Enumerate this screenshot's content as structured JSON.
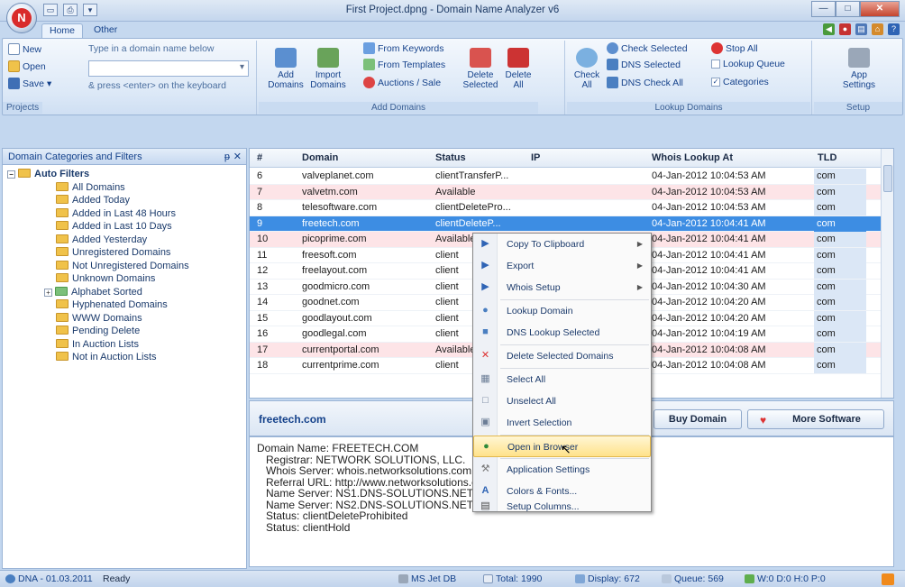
{
  "window": {
    "title": "First Project.dpng - Domain Name Analyzer v6",
    "app_letter": "N"
  },
  "tabs": [
    "Home",
    "Other"
  ],
  "ribbon": {
    "projects": {
      "new": "New",
      "open": "Open",
      "save": "Save",
      "save_arrow": "▾",
      "label": "Projects",
      "hint_top": "Type in a domain name below",
      "hint_bottom": "& press <enter> on the keyboard"
    },
    "add_domains": {
      "add": "Add Domains",
      "import": "Import Domains",
      "from_keywords": "From Keywords",
      "from_templates": "From Templates",
      "auctions": "Auctions / Sale",
      "delete_selected": "Delete Selected",
      "delete_all": "Delete All",
      "label": "Add Domains"
    },
    "lookup": {
      "check_all": "Check All",
      "check_selected": "Check Selected",
      "dns_selected": "DNS Selected",
      "dns_check_all": "DNS Check All",
      "stop_all": "Stop All",
      "lookup_queue": "Lookup Queue",
      "categories": "Categories",
      "label": "Lookup Domains"
    },
    "setup": {
      "app_settings": "App Settings",
      "label": "Setup"
    }
  },
  "left_pane": {
    "title": "Domain Categories and Filters",
    "pin": "ᵽ",
    "close": "✕",
    "exp_minus": "−",
    "exp_plus": "+",
    "root": "Auto Filters",
    "items": [
      "All Domains",
      "Added Today",
      "Added in Last 48 Hours",
      "Added in Last 10 Days",
      "Added Yesterday",
      "Unregistered Domains",
      "Not Unregistered Domains",
      "Unknown Domains",
      "Alphabet Sorted",
      "Hyphenated Domains",
      "WWW Domains",
      "Pending Delete",
      "In Auction Lists",
      "Not in Auction Lists"
    ]
  },
  "grid": {
    "headers": {
      "num": "#",
      "domain": "Domain",
      "status": "Status",
      "ip": "IP",
      "whois": "Whois Lookup At",
      "tld": "TLD"
    },
    "rows": [
      {
        "n": "6",
        "domain": "valveplanet.com",
        "status": "clientTransferP...",
        "whois": "04-Jan-2012 10:04:53 AM",
        "tld": "com",
        "kind": "normal"
      },
      {
        "n": "7",
        "domain": "valvetm.com",
        "status": "Available",
        "whois": "04-Jan-2012 10:04:53 AM",
        "tld": "com",
        "kind": "avail"
      },
      {
        "n": "8",
        "domain": "telesoftware.com",
        "status": "clientDeletePro...",
        "whois": "04-Jan-2012 10:04:53 AM",
        "tld": "com",
        "kind": "normal"
      },
      {
        "n": "9",
        "domain": "freetech.com",
        "status": "clientDeleteP...",
        "whois": "04-Jan-2012 10:04:41 AM",
        "tld": "com",
        "kind": "sel"
      },
      {
        "n": "10",
        "domain": "picoprime.com",
        "status": "Available",
        "whois": "04-Jan-2012 10:04:41 AM",
        "tld": "com",
        "kind": "avail"
      },
      {
        "n": "11",
        "domain": "freesoft.com",
        "status": "client",
        "whois": "04-Jan-2012 10:04:41 AM",
        "tld": "com",
        "kind": "normal"
      },
      {
        "n": "12",
        "domain": "freelayout.com",
        "status": "client",
        "whois": "04-Jan-2012 10:04:41 AM",
        "tld": "com",
        "kind": "normal"
      },
      {
        "n": "13",
        "domain": "goodmicro.com",
        "status": "client",
        "whois": "04-Jan-2012 10:04:30 AM",
        "tld": "com",
        "kind": "normal"
      },
      {
        "n": "14",
        "domain": "goodnet.com",
        "status": "client",
        "whois": "04-Jan-2012 10:04:20 AM",
        "tld": "com",
        "kind": "normal"
      },
      {
        "n": "15",
        "domain": "goodlayout.com",
        "status": "client",
        "whois": "04-Jan-2012 10:04:20 AM",
        "tld": "com",
        "kind": "normal"
      },
      {
        "n": "16",
        "domain": "goodlegal.com",
        "status": "client",
        "whois": "04-Jan-2012 10:04:19 AM",
        "tld": "com",
        "kind": "normal"
      },
      {
        "n": "17",
        "domain": "currentportal.com",
        "status": "Available",
        "whois": "04-Jan-2012 10:04:08 AM",
        "tld": "com",
        "kind": "avail"
      },
      {
        "n": "18",
        "domain": "currentprime.com",
        "status": "client",
        "whois": "04-Jan-2012 10:04:08 AM",
        "tld": "com",
        "kind": "normal"
      }
    ]
  },
  "detail": {
    "domain": "freetech.com",
    "buy": "Buy Domain",
    "more": "More Software",
    "lines": [
      "Domain Name: FREETECH.COM",
      "Registrar: NETWORK SOLUTIONS, LLC.",
      "Whois Server: whois.networksolutions.com",
      "Referral URL: http://www.networksolutions.com",
      "Name Server: NS1.DNS-SOLUTIONS.NET",
      "Name Server: NS2.DNS-SOLUTIONS.NET",
      "Status: clientDeleteProhibited",
      "Status: clientHold"
    ]
  },
  "context_menu": {
    "items": [
      {
        "label": "Copy To Clipboard",
        "submenu": true
      },
      {
        "label": "Export",
        "submenu": true
      },
      {
        "label": "Whois Setup",
        "submenu": true
      },
      {
        "label": "Lookup Domain"
      },
      {
        "label": "DNS Lookup Selected"
      },
      {
        "label": "Delete Selected Domains"
      },
      {
        "label": "Select All"
      },
      {
        "label": "Unselect All"
      },
      {
        "label": "Invert Selection"
      },
      {
        "label": "Open in Browser",
        "highlighted": true
      },
      {
        "label": "Application Settings"
      },
      {
        "label": "Colors & Fonts..."
      },
      {
        "label": "Setup Columns..."
      }
    ]
  },
  "status": {
    "version": "DNA - 01.03.2011",
    "state": "Ready",
    "db": "MS Jet DB",
    "total": "Total: 1990",
    "display": "Display: 672",
    "queue": "Queue: 569",
    "counters": "W:0 D:0 H:0 P:0"
  },
  "colors": {
    "selected_row": "#3d8de3",
    "available_row": "#fde4e7",
    "ribbon_bg": "#dde9f7",
    "menu_highlight": "#ffe28a"
  }
}
